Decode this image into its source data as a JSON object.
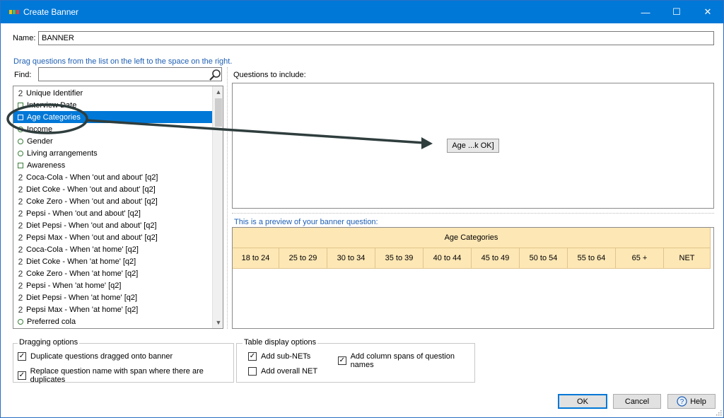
{
  "window": {
    "title": "Create Banner",
    "controls": {
      "minimize": "—",
      "maximize": "☐",
      "close": "✕"
    }
  },
  "name": {
    "label": "Name:",
    "value": "BANNER"
  },
  "hint": "Drag questions from the list on the left to the space on the right.",
  "find": {
    "label": "Find:",
    "value": ""
  },
  "questions": [
    {
      "icon": "2",
      "type": "numeric",
      "label": "Unique Identifier"
    },
    {
      "icon": "date",
      "type": "date",
      "label": "Interview Date"
    },
    {
      "icon": "box",
      "type": "single",
      "label": "Age Categories",
      "selected": true
    },
    {
      "icon": "rad",
      "type": "radio",
      "label": "Income"
    },
    {
      "icon": "rad",
      "type": "radio",
      "label": "Gender"
    },
    {
      "icon": "rad",
      "type": "radio",
      "label": "Living arrangements"
    },
    {
      "icon": "box",
      "type": "multi",
      "label": "Awareness"
    },
    {
      "icon": "2",
      "type": "numeric",
      "label": "Coca-Cola - When 'out and about' [q2]"
    },
    {
      "icon": "2",
      "type": "numeric",
      "label": "Diet Coke - When 'out and about' [q2]"
    },
    {
      "icon": "2",
      "type": "numeric",
      "label": "Coke Zero - When 'out and about' [q2]"
    },
    {
      "icon": "2",
      "type": "numeric",
      "label": "Pepsi - When 'out and about' [q2]"
    },
    {
      "icon": "2",
      "type": "numeric",
      "label": "Diet Pepsi - When 'out and about' [q2]"
    },
    {
      "icon": "2",
      "type": "numeric",
      "label": "Pepsi Max - When 'out and about' [q2]"
    },
    {
      "icon": "2",
      "type": "numeric",
      "label": "Coca-Cola - When 'at home' [q2]"
    },
    {
      "icon": "2",
      "type": "numeric",
      "label": "Diet Coke - When 'at home' [q2]"
    },
    {
      "icon": "2",
      "type": "numeric",
      "label": "Coke Zero - When 'at home' [q2]"
    },
    {
      "icon": "2",
      "type": "numeric",
      "label": "Pepsi - When 'at home' [q2]"
    },
    {
      "icon": "2",
      "type": "numeric",
      "label": "Diet Pepsi - When 'at home' [q2]"
    },
    {
      "icon": "2",
      "type": "numeric",
      "label": "Pepsi Max - When 'at home' [q2]"
    },
    {
      "icon": "rad",
      "type": "radio",
      "label": "Preferred cola"
    }
  ],
  "include": {
    "label": "Questions to include:",
    "drag_item": "Age ...k OK]"
  },
  "preview": {
    "label": "This is a preview of your banner question:",
    "header": "Age Categories",
    "columns": [
      "18 to 24",
      "25 to 29",
      "30 to 34",
      "35 to 39",
      "40 to 44",
      "45 to 49",
      "50 to 54",
      "55 to 64",
      "65 +",
      "NET"
    ]
  },
  "dragging_options": {
    "title": "Dragging options",
    "items": [
      {
        "label": "Duplicate questions dragged onto banner",
        "checked": true
      },
      {
        "label": "Replace question name with span where there are duplicates",
        "checked": true
      }
    ]
  },
  "table_display_options": {
    "title": "Table display options",
    "items": [
      {
        "label": "Add sub-NETs",
        "checked": true
      },
      {
        "label": "Add column spans of question names",
        "checked": true
      },
      {
        "label": "Add overall NET",
        "checked": false
      }
    ]
  },
  "buttons": {
    "ok": "OK",
    "cancel": "Cancel",
    "help": "Help"
  },
  "colors": {
    "title_bar": "#0078d7",
    "selection": "#0078d7",
    "hint_text": "#1e5fb4",
    "banner_fill": "#fde7b5",
    "annotation": "#2f3d3d"
  }
}
